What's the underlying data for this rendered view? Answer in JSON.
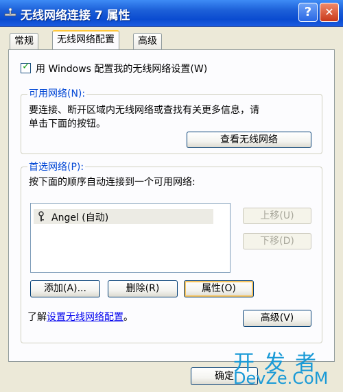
{
  "window": {
    "title": "无线网络连接 7 属性"
  },
  "titlebar": {
    "help_label": "?",
    "close_label": "✕"
  },
  "tabs": [
    {
      "label": "常规"
    },
    {
      "label": "无线网络配置"
    },
    {
      "label": "高级"
    }
  ],
  "config_checkbox": {
    "checked": true,
    "label": "用 Windows 配置我的无线网络设置(W)"
  },
  "available_networks": {
    "legend": "可用网络(N):",
    "desc_line1": "要连接、断开区域内无线网络或查找有关更多信息，请",
    "desc_line2": "单击下面的按钮。",
    "view_button": "查看无线网络"
  },
  "preferred_networks": {
    "legend": "首选网络(P):",
    "desc": "按下面的顺序自动连接到一个可用网络:",
    "items": [
      {
        "label": "Angel (自动)"
      }
    ],
    "move_up": "上移(U)",
    "move_down": "下移(D)",
    "add": "添加(A)...",
    "remove": "删除(R)",
    "properties": "属性(O)"
  },
  "learn": {
    "prefix": "了解",
    "link": "设置无线网络配置",
    "suffix": "。"
  },
  "advanced_button": "高级(V)",
  "footer": {
    "ok": "确定"
  },
  "watermark": {
    "line1": "开发者",
    "line2": "DevZe.CoM"
  }
}
